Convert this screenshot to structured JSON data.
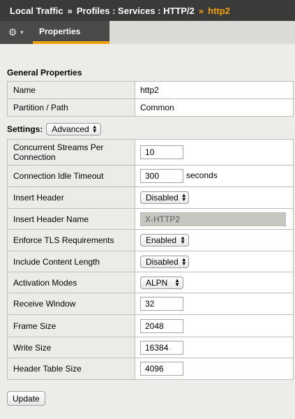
{
  "breadcrumb": {
    "items": [
      "Local Traffic",
      "Profiles : Services : HTTP/2"
    ],
    "separator": "»",
    "current": "http2"
  },
  "tabs": {
    "gear_icon": "gear-icon",
    "active": "Properties"
  },
  "general": {
    "title": "General Properties",
    "rows": [
      {
        "label": "Name",
        "value": "http2"
      },
      {
        "label": "Partition / Path",
        "value": "Common"
      }
    ]
  },
  "settings": {
    "label": "Settings:",
    "mode": "Advanced",
    "rows": [
      {
        "label": "Concurrent Streams Per Connection",
        "type": "input",
        "value": "10"
      },
      {
        "label": "Connection Idle Timeout",
        "type": "input",
        "value": "300",
        "unit": "seconds"
      },
      {
        "label": "Insert Header",
        "type": "select",
        "value": "Disabled"
      },
      {
        "label": "Insert Header Name",
        "type": "disabled-input",
        "value": "X-HTTP2"
      },
      {
        "label": "Enforce TLS Requirements",
        "type": "select",
        "value": "Enabled"
      },
      {
        "label": "Include Content Length",
        "type": "select",
        "value": "Disabled"
      },
      {
        "label": "Activation Modes",
        "type": "select",
        "value": "ALPN"
      },
      {
        "label": "Receive Window",
        "type": "input",
        "value": "32"
      },
      {
        "label": "Frame Size",
        "type": "input",
        "value": "2048"
      },
      {
        "label": "Write Size",
        "type": "input",
        "value": "16384"
      },
      {
        "label": "Header Table Size",
        "type": "input",
        "value": "4096"
      }
    ]
  },
  "actions": {
    "update": "Update"
  },
  "colors": {
    "header_bg": "#3a3a3a",
    "accent": "#f0a30a",
    "label_bg": "#ebebe8"
  }
}
